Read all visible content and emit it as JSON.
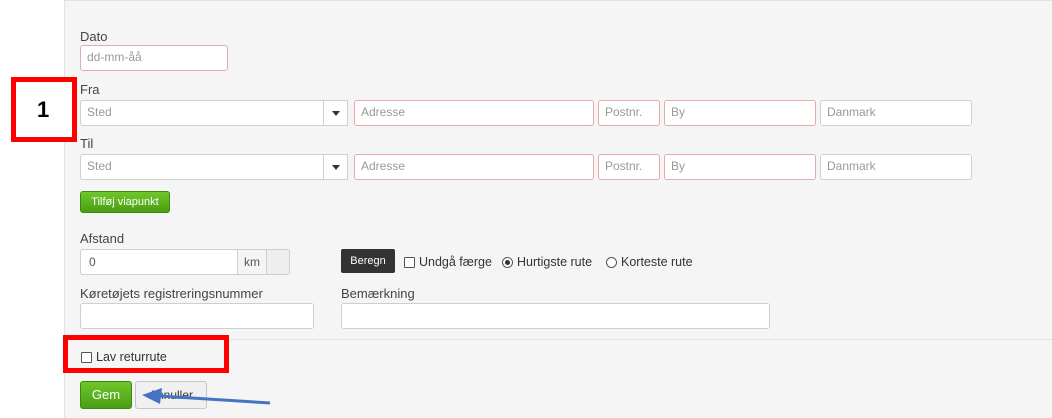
{
  "form": {
    "date_label": "Dato",
    "date_placeholder": "dd-mm-åå",
    "from_label": "Fra",
    "to_label": "Til",
    "place_placeholder": "Sted",
    "address_placeholder": "Adresse",
    "postal_placeholder": "Postnr.",
    "city_placeholder": "By",
    "country_placeholder": "Danmark",
    "add_waypoint_label": "Tilføj viapunkt",
    "distance_label": "Afstand",
    "distance_value": "0",
    "distance_unit": "km",
    "calculate_label": "Beregn",
    "avoid_ferry_label": "Undgå færge",
    "fastest_route_label": "Hurtigste rute",
    "shortest_route_label": "Korteste rute",
    "selected_route": "Hurtigste rute",
    "registration_label": "Køretøjets registreringsnummer",
    "remark_label": "Bemærkning",
    "return_route_label": "Lav returrute",
    "save_label": "Gem",
    "cancel_label": "Annuller"
  },
  "annotations": {
    "step_number": "1",
    "highlight_color": "#ff0000",
    "arrow_color": "#4472c4"
  }
}
